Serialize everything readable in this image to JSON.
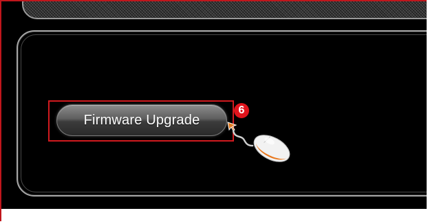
{
  "firmware_button": {
    "label": "Firmware Upgrade"
  },
  "annotation": {
    "step_number": "6"
  },
  "icons": {
    "pointer": "mouse-click-icon"
  },
  "colors": {
    "highlight": "#d21a1f",
    "badge": "#e0141c",
    "background": "#000000",
    "button": "#4a4a4a"
  }
}
